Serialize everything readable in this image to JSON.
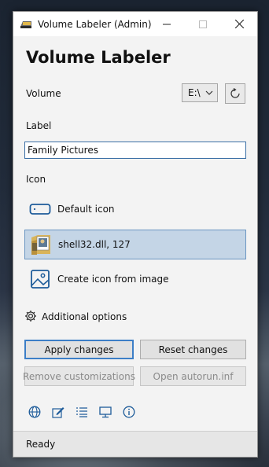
{
  "window": {
    "title": "Volume Labeler (Admin)",
    "icon": "drive-app-icon"
  },
  "main": {
    "heading": "Volume Labeler",
    "volume_label": "Volume",
    "drive_value": "E:\\",
    "label_caption": "Label",
    "label_value": "Family Pictures",
    "icon_caption": "Icon",
    "icon_options": [
      {
        "label": "Default icon",
        "icon": "drive-icon",
        "selected": false
      },
      {
        "label": "shell32.dll, 127",
        "icon": "folder-pictures-icon",
        "selected": true
      },
      {
        "label": "Create icon from image",
        "icon": "image-icon",
        "selected": false
      }
    ],
    "additional_options": "Additional options"
  },
  "buttons": {
    "apply": "Apply changes",
    "reset": "Reset changes",
    "remove": "Remove customizations",
    "autorun": "Open autorun.inf"
  },
  "footer_icons": [
    "globe-icon",
    "edit-icon",
    "list-icon",
    "monitor-icon",
    "info-icon"
  ],
  "status": {
    "text": "Ready"
  },
  "colors": {
    "selection_bg": "#c4d5e6",
    "selection_border": "#6b96c2",
    "accent": "#3d7fc7",
    "icon_blue": "#1e5c9a"
  }
}
